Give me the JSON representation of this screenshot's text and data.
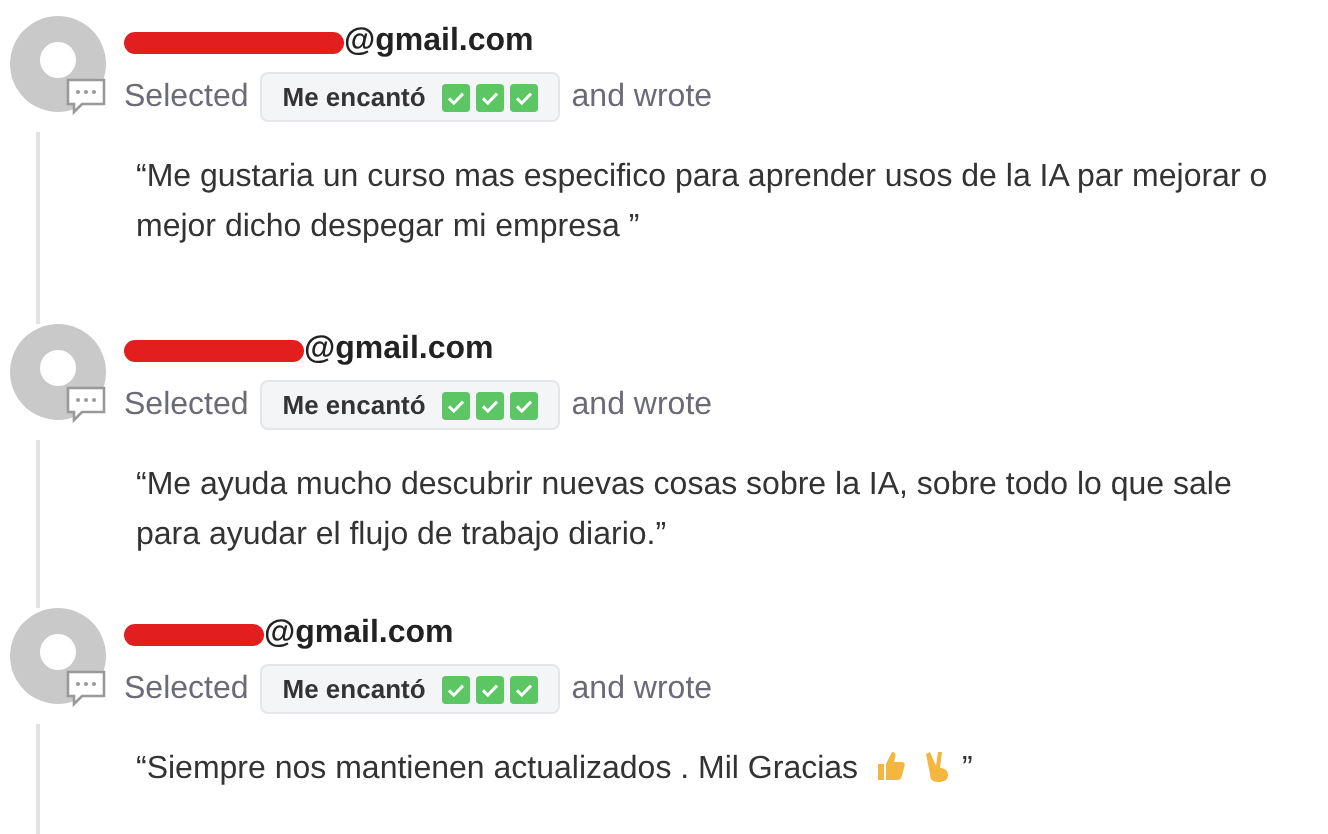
{
  "responses": [
    {
      "email": "@gmail.com",
      "prefix": "Selected",
      "choice": "Me encantó",
      "suffix": "and wrote",
      "comment": "“Me gustaria un curso mas especifico para aprender usos de la IA par mejorar o mejor dicho despegar mi empresa ”"
    },
    {
      "email": "@gmail.com",
      "prefix": "Selected",
      "choice": "Me encantó",
      "suffix": "and wrote",
      "comment": "“Me ayuda mucho descubrir nuevas cosas sobre la IA, sobre todo lo que sale para ayudar el flujo de trabajo diario.”"
    },
    {
      "email": "@gmail.com",
      "prefix": "Selected",
      "choice": "Me encantó",
      "suffix": "and wrote",
      "comment": "“Siempre nos mantienen actualizados . Mil Gracias",
      "has_emoji": true,
      "comment_end": "”"
    }
  ]
}
